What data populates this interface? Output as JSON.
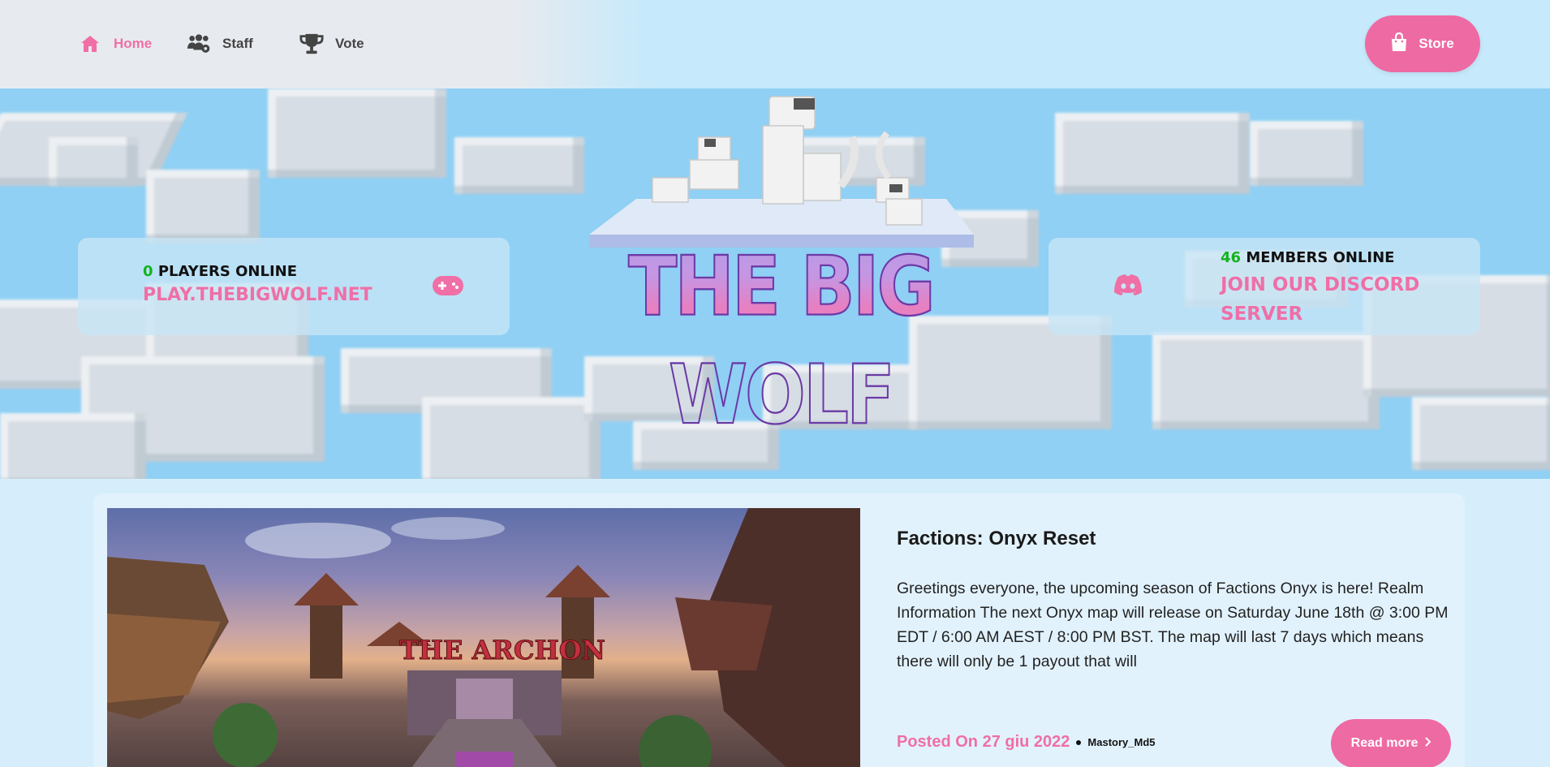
{
  "nav": {
    "items": [
      {
        "label": "Home",
        "icon": "home-icon",
        "active": true
      },
      {
        "label": "Staff",
        "icon": "staff-icon",
        "active": false
      },
      {
        "label": "Vote",
        "icon": "trophy-icon",
        "active": false
      }
    ],
    "store_label": "Store",
    "store_icon": "shopping-bag-icon"
  },
  "hero": {
    "logo_text": "THE BIG WOLF",
    "players": {
      "count": "0",
      "label": "PLAYERS ONLINE",
      "address": "PLAY.THEBIGWOLF.NET",
      "icon": "gamepad-icon"
    },
    "discord": {
      "count": "46",
      "label": "MEMBERS ONLINE",
      "link_line1": "JOIN OUR DISCORD",
      "link_line2": "SERVER",
      "icon": "discord-icon"
    }
  },
  "post": {
    "title": "Factions: Onyx Reset",
    "body": "Greetings everyone, the upcoming season of Factions Onyx is here! Realm Information The next Onyx map will release on Saturday June 18th @ 3:00 PM EDT / 6:00 AM AEST / 8:00 PM BST. The map will last 7 days which means there will only be 1 payout that will",
    "posted": "Posted On 27 giu 2022",
    "author": "Mastory_Md5",
    "read_more": "Read more",
    "image_text": "THE ARCHON"
  },
  "colors": {
    "accent": "#ee6aa3",
    "online": "#14b31e",
    "sky": "#8fd0f4"
  }
}
